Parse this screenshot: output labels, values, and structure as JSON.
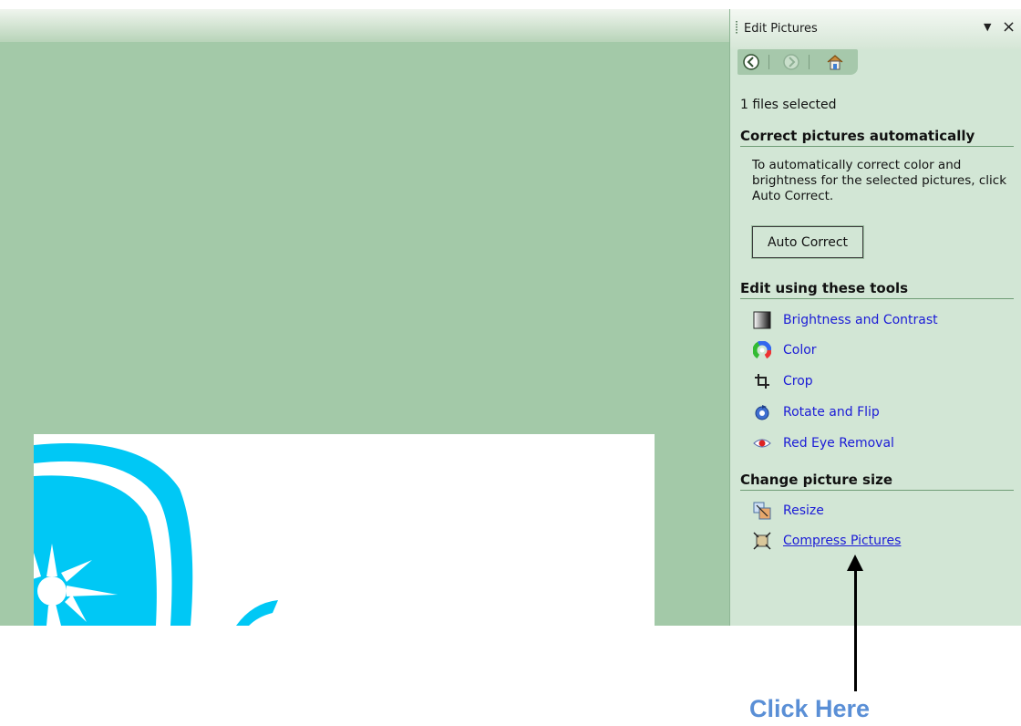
{
  "pane": {
    "title": "Edit Pictures",
    "close_glyph": "×",
    "dropdown_glyph": "▼",
    "nav": {
      "back_icon": "back-icon",
      "forward_icon": "forward-icon",
      "home_icon": "home-icon"
    }
  },
  "file_info": "1 files selected",
  "auto": {
    "heading": "Correct pictures automatically",
    "description": "To automatically correct color and brightness for the selected pictures, click Auto Correct.",
    "button_label": "Auto Correct"
  },
  "tools": {
    "heading": "Edit using these tools",
    "items": [
      {
        "label": "Brightness and Contrast",
        "icon": "brightness-icon"
      },
      {
        "label": "Color",
        "icon": "color-wheel-icon"
      },
      {
        "label": "Crop",
        "icon": "crop-icon"
      },
      {
        "label": "Rotate and Flip",
        "icon": "rotate-icon"
      },
      {
        "label": "Red Eye Removal",
        "icon": "red-eye-icon"
      }
    ]
  },
  "size": {
    "heading": "Change picture size",
    "items": [
      {
        "label": "Resize",
        "icon": "resize-icon"
      },
      {
        "label": "Compress Pictures",
        "icon": "compress-icon"
      }
    ]
  },
  "callout": {
    "text": "Click Here"
  },
  "colors": {
    "workspace": "#a3c9a8",
    "pane": "#d2e6d5",
    "link": "#1b1bd6",
    "callout": "#5a8fd6",
    "logo": "#00c8f5"
  }
}
